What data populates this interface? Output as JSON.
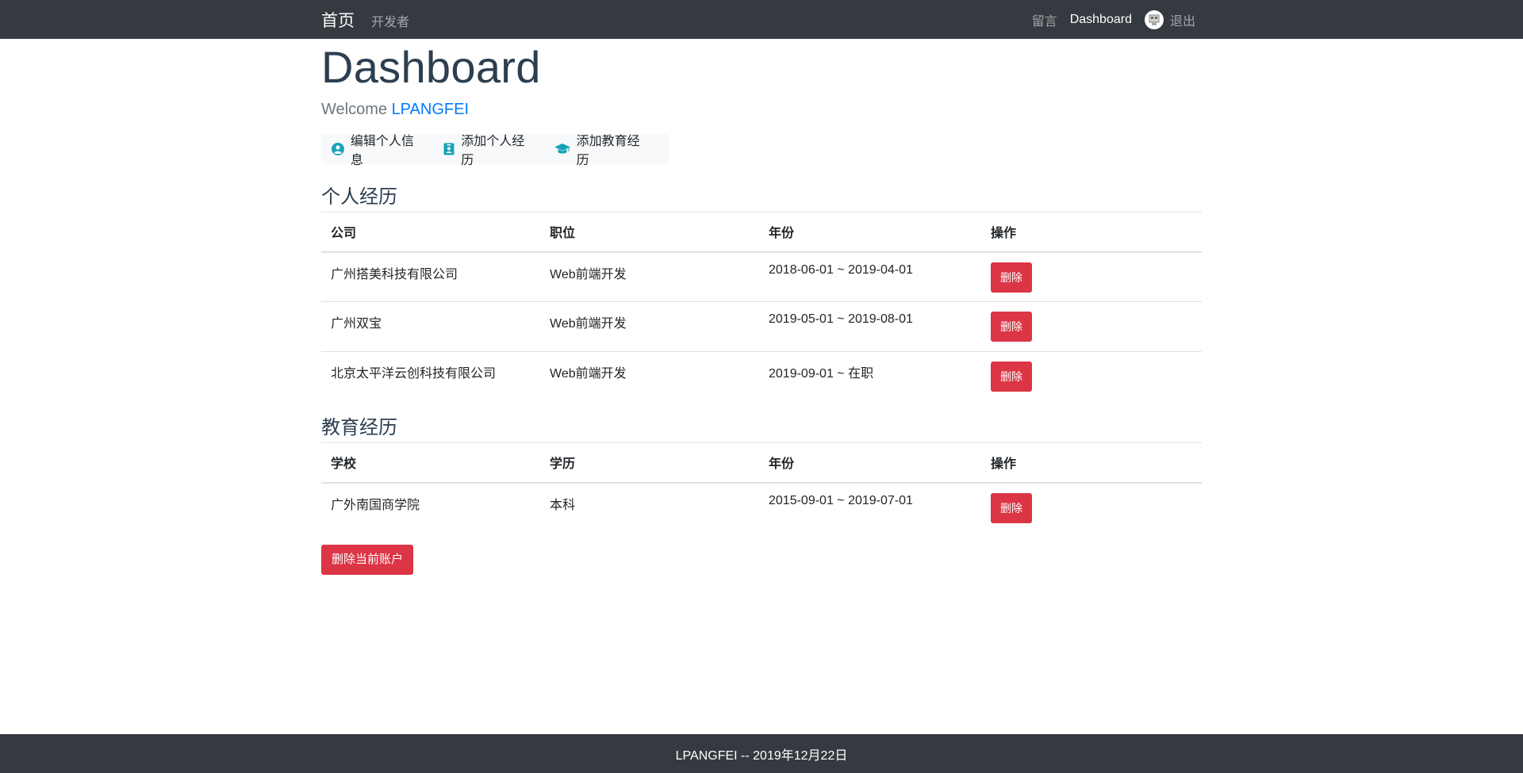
{
  "nav": {
    "brand": "首页",
    "developers": "开发者",
    "messages": "留言",
    "dashboard": "Dashboard",
    "logout": "退出"
  },
  "page": {
    "title": "Dashboard",
    "welcome_prefix": "Welcome",
    "username": "LPANGFEI"
  },
  "actions": {
    "edit_profile": "编辑个人信息",
    "add_experience": "添加个人经历",
    "add_education": "添加教育经历"
  },
  "experience": {
    "title": "个人经历",
    "headers": [
      "公司",
      "职位",
      "年份",
      "操作"
    ],
    "rows": [
      {
        "company": "广州搭美科技有限公司",
        "position": "Web前端开发",
        "years": "2018-06-01 ~ 2019-04-01",
        "action": "删除"
      },
      {
        "company": "广州双宝",
        "position": "Web前端开发",
        "years": "2019-05-01 ~ 2019-08-01",
        "action": "删除"
      },
      {
        "company": "北京太平洋云创科技有限公司",
        "position": "Web前端开发",
        "years": "2019-09-01 ~ 在职",
        "action": "删除"
      }
    ]
  },
  "education": {
    "title": "教育经历",
    "headers": [
      "学校",
      "学历",
      "年份",
      "操作"
    ],
    "rows": [
      {
        "school": "广外南国商学院",
        "degree": "本科",
        "years": "2015-09-01 ~ 2019-07-01",
        "action": "删除"
      }
    ]
  },
  "delete_account": "删除当前账户",
  "footer": "LPANGFEI -- 2019年12月22日",
  "colors": {
    "navbar": "#343a40",
    "danger": "#dc3545",
    "link": "#007bff",
    "icon": "#17a2b8",
    "heading": "#2c3e50"
  },
  "icons": {
    "avatar": "user-avatar-icon",
    "edit_profile": "user-circle-icon",
    "add_experience": "id-badge-icon",
    "add_education": "graduation-cap-icon"
  }
}
